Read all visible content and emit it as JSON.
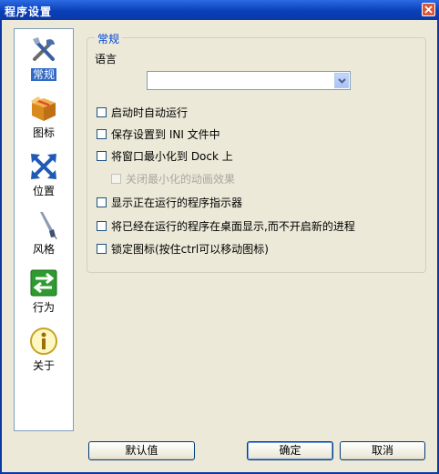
{
  "window": {
    "title": "程序设置"
  },
  "sidebar": {
    "items": [
      {
        "label": "常规",
        "icon": "tools-icon",
        "active": true
      },
      {
        "label": "图标",
        "icon": "box-icon"
      },
      {
        "label": "位置",
        "icon": "move-arrows-icon"
      },
      {
        "label": "风格",
        "icon": "brush-icon"
      },
      {
        "label": "行为",
        "icon": "exchange-arrows-icon"
      },
      {
        "label": "关于",
        "icon": "info-icon"
      }
    ]
  },
  "general": {
    "group_title": "常规",
    "language_label": "语言",
    "language_value": "",
    "options": [
      {
        "label": "启动时自动运行",
        "checked": false,
        "enabled": true
      },
      {
        "label": "保存设置到 INI 文件中",
        "checked": false,
        "enabled": true
      },
      {
        "label": "将窗口最小化到 Dock 上",
        "checked": false,
        "enabled": true
      },
      {
        "label": "关闭最小化的动画效果",
        "checked": false,
        "enabled": false
      },
      {
        "label": "显示正在运行的程序指示器",
        "checked": false,
        "enabled": true
      },
      {
        "label": "将已经在运行的程序在桌面显示,而不开启新的进程",
        "checked": false,
        "enabled": true
      },
      {
        "label": "锁定图标(按住ctrl可以移动图标)",
        "checked": false,
        "enabled": true
      }
    ]
  },
  "buttons": {
    "defaults": "默认值",
    "ok": "确定",
    "cancel": "取消"
  },
  "colors": {
    "titlebar": "#0a3fb8",
    "dialog_bg": "#ece9d8",
    "selection": "#316ac5",
    "group_title": "#0046d5"
  }
}
